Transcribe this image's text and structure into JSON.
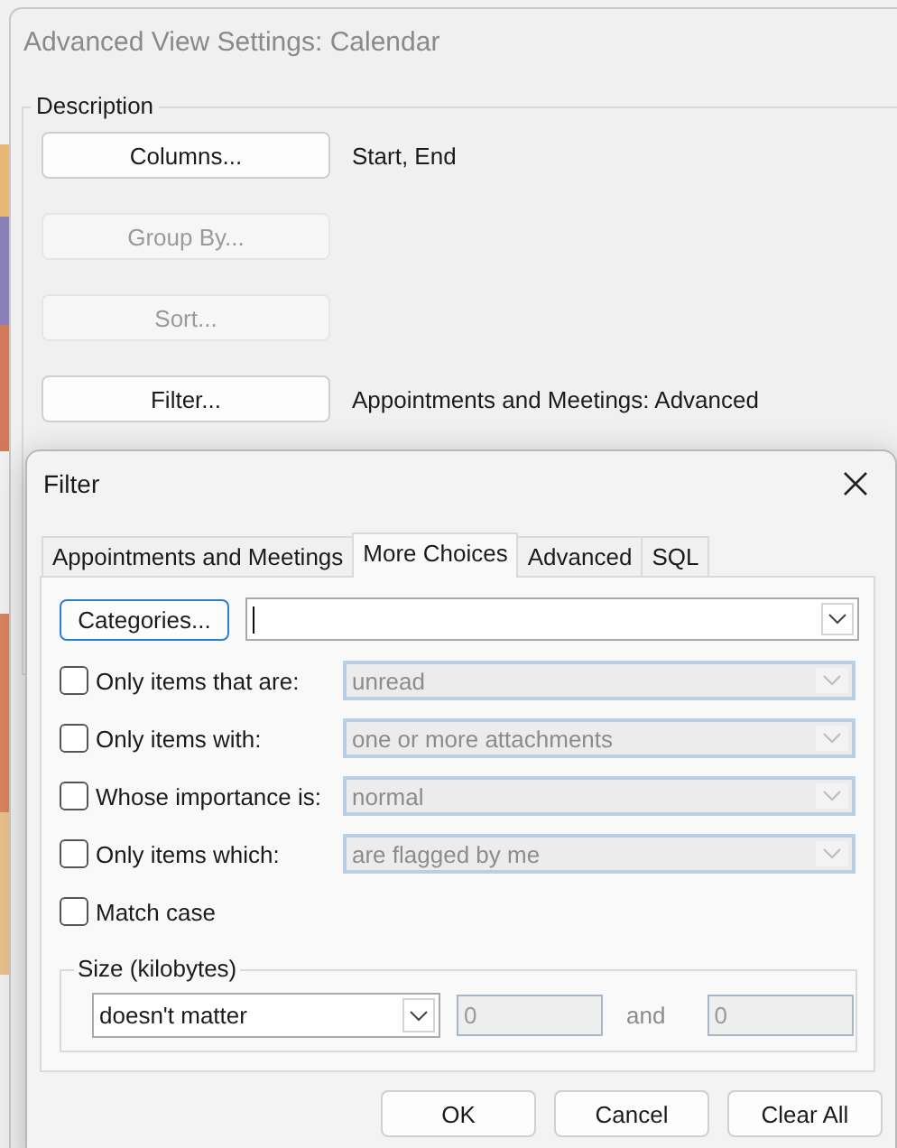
{
  "window": {
    "title": "Advanced View Settings: Calendar"
  },
  "description": {
    "label": "Description",
    "rows": [
      {
        "button": "Columns...",
        "disabled": false,
        "value": "Start, End"
      },
      {
        "button": "Group By...",
        "disabled": true
      },
      {
        "button": "Sort...",
        "disabled": true
      },
      {
        "button": "Filter...",
        "disabled": false,
        "value": "Appointments and Meetings: Advanced"
      }
    ]
  },
  "filter_dialog": {
    "title": "Filter",
    "tabs": [
      {
        "label": "Appointments and Meetings",
        "selected": false
      },
      {
        "label": "More Choices",
        "selected": true
      },
      {
        "label": "Advanced",
        "selected": false
      },
      {
        "label": "SQL",
        "selected": false
      }
    ],
    "categories": {
      "button": "Categories...",
      "focused": true
    },
    "options": [
      {
        "label": "Only items that are:",
        "checked": false,
        "value": "unread"
      },
      {
        "label": "Only items with:",
        "checked": false,
        "value": "one or more attachments"
      },
      {
        "label": "Whose importance is:",
        "checked": false,
        "value": "normal"
      },
      {
        "label": "Only items which:",
        "checked": false,
        "value": "are flagged by me"
      }
    ],
    "match_case": {
      "label": "Match case",
      "checked": false
    },
    "size": {
      "label": "Size (kilobytes)",
      "condition": "doesn't matter",
      "from": "0",
      "joiner": "and",
      "to": "0"
    },
    "buttons": [
      "OK",
      "Cancel",
      "Clear All"
    ]
  }
}
